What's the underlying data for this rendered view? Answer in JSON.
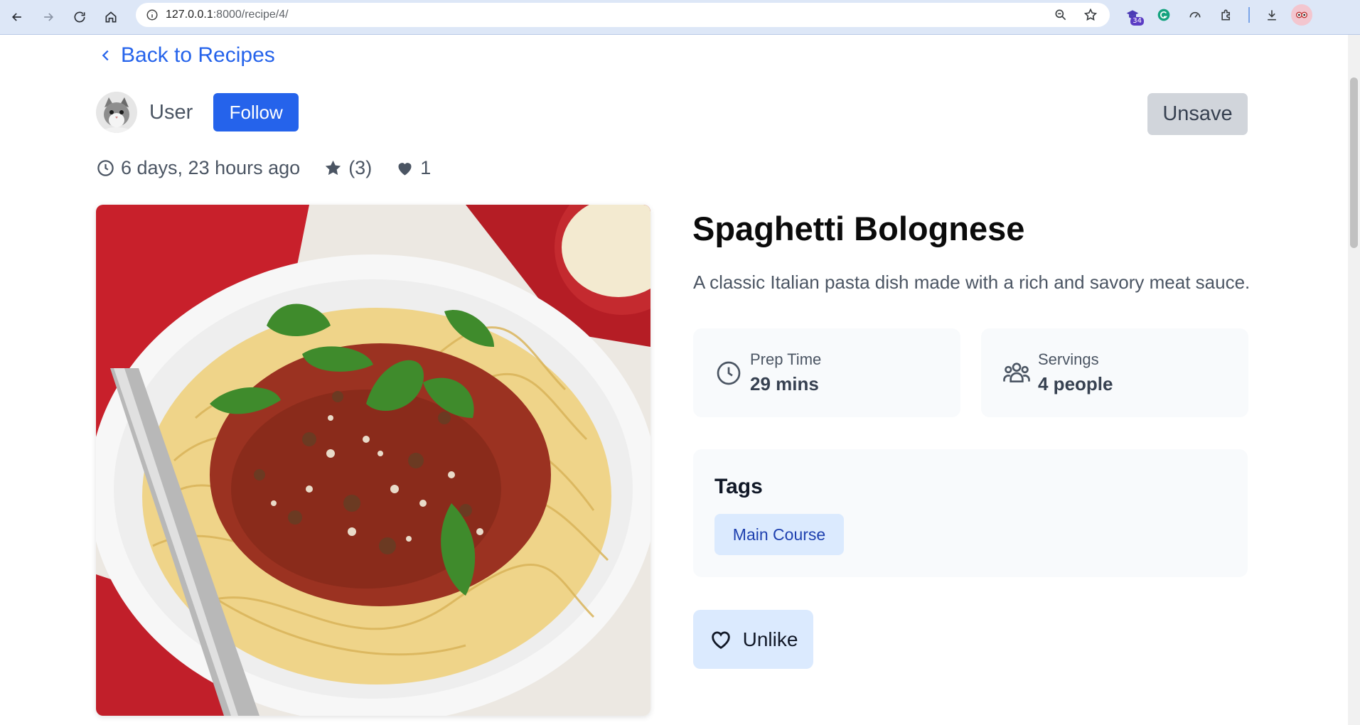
{
  "browser": {
    "url_host": "127.0.0.1",
    "url_rest": ":8000/recipe/4/",
    "extension_badge": "34"
  },
  "page": {
    "back_link": "Back to Recipes",
    "author": {
      "name": "User",
      "follow_label": "Follow"
    },
    "unsave_label": "Unsave",
    "meta": {
      "posted": "6 days, 23 hours ago",
      "rating_count": "(3)",
      "likes": "1"
    },
    "recipe": {
      "title": "Spaghetti Bolognese",
      "description": "A classic Italian pasta dish made with a rich and savory meat sauce.",
      "prep_label": "Prep Time",
      "prep_value": "29 mins",
      "servings_label": "Servings",
      "servings_value": "4 people"
    },
    "tags": {
      "heading": "Tags",
      "items": [
        "Main Course"
      ]
    },
    "unlike_label": "Unlike"
  },
  "colors": {
    "primary": "#2563eb",
    "tag_bg": "#dbeafe",
    "card_bg": "#f8fafc"
  }
}
